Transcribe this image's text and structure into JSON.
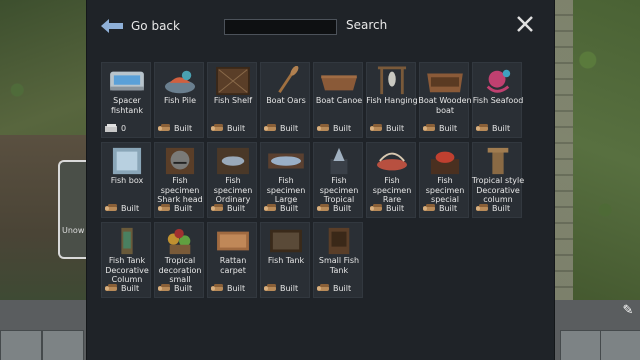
{
  "header": {
    "back_label": "Go back",
    "search_label": "Search",
    "search_value": ""
  },
  "background": {
    "partial_label": "Unow"
  },
  "items": [
    {
      "name": "Spacer fishtank",
      "status": "0",
      "icon": "spacer-fishtank-icon"
    },
    {
      "name": "Fish Pile",
      "status": "Built",
      "icon": "fish-pile-icon"
    },
    {
      "name": "Fish Shelf",
      "status": "Built",
      "icon": "fish-shelf-icon"
    },
    {
      "name": "Boat Oars",
      "status": "Built",
      "icon": "boat-oars-icon"
    },
    {
      "name": "Boat Canoe",
      "status": "Built",
      "icon": "boat-canoe-icon"
    },
    {
      "name": "Fish Hanging",
      "status": "Built",
      "icon": "fish-hanging-icon"
    },
    {
      "name": "Boat Wooden boat",
      "status": "Built",
      "icon": "wooden-boat-icon"
    },
    {
      "name": "Fish Seafood",
      "status": "Built",
      "icon": "seafood-icon"
    },
    {
      "name": "Fish box",
      "status": "Built",
      "icon": "fish-box-icon"
    },
    {
      "name": "Fish specimen Shark head",
      "status": "Built",
      "icon": "shark-head-icon"
    },
    {
      "name": "Fish specimen Ordinary",
      "status": "Built",
      "icon": "fish-specimen-ordinary-icon"
    },
    {
      "name": "Fish specimen Large",
      "status": "Built",
      "icon": "fish-specimen-large-icon"
    },
    {
      "name": "Fish specimen Tropical",
      "status": "Built",
      "icon": "fish-specimen-tropical-icon"
    },
    {
      "name": "Fish specimen Rare",
      "status": "Built",
      "icon": "fish-specimen-rare-icon"
    },
    {
      "name": "Fish specimen special",
      "status": "Built",
      "icon": "fish-specimen-special-icon"
    },
    {
      "name": "Tropical style Decorative column",
      "status": "Built",
      "icon": "tropical-column-icon"
    },
    {
      "name": "Fish Tank Decorative Column",
      "status": "Built",
      "icon": "fish-tank-column-icon"
    },
    {
      "name": "Tropical decoration small",
      "status": "Built",
      "icon": "tropical-decoration-icon"
    },
    {
      "name": "Rattan carpet",
      "status": "Built",
      "icon": "rattan-carpet-icon"
    },
    {
      "name": "Fish Tank",
      "status": "Built",
      "icon": "fish-tank-icon"
    },
    {
      "name": "Small Fish Tank",
      "status": "Built",
      "icon": "small-fish-tank-icon"
    }
  ],
  "colors": {
    "dialog_bg": "#1f2328",
    "cell_bg": "#2a2f35",
    "accent": "#8fb0d8"
  }
}
